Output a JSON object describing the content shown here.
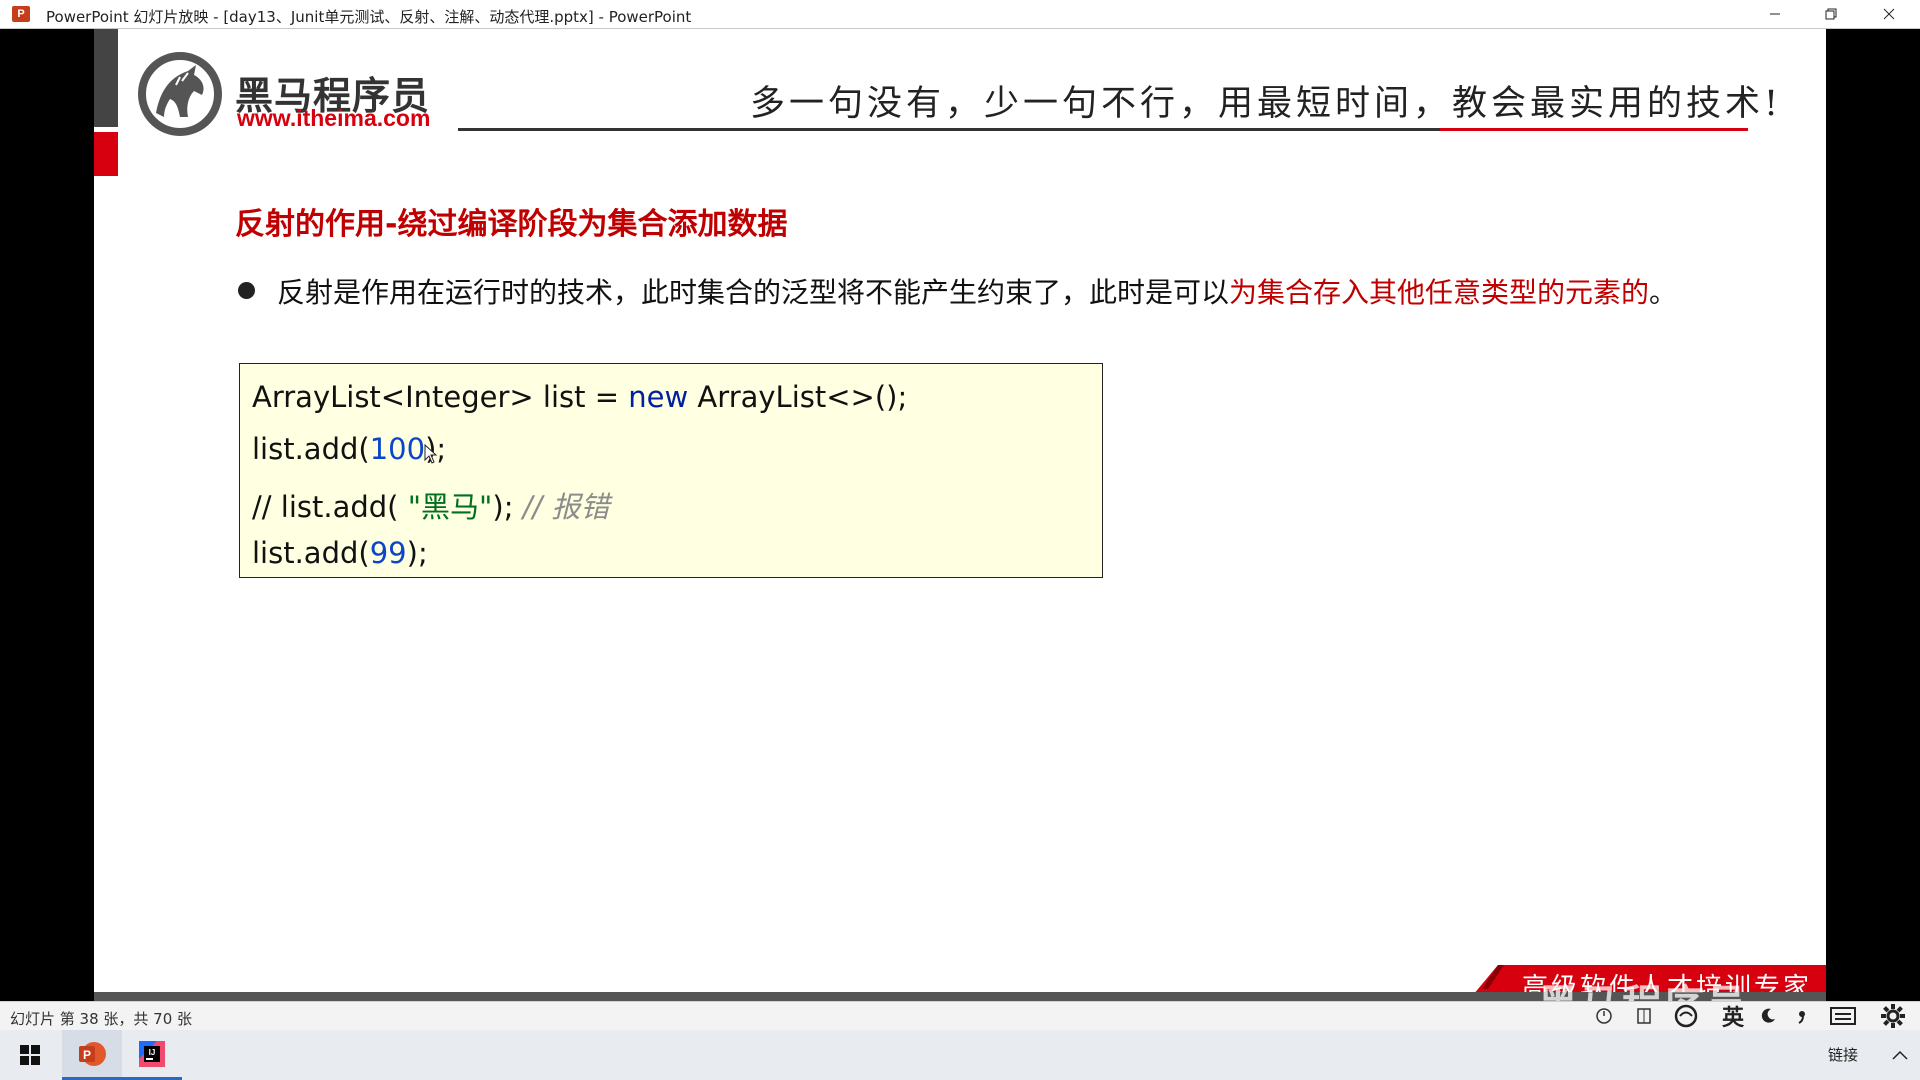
{
  "window": {
    "title": "PowerPoint 幻灯片放映 - [day13、Junit单元测试、反射、注解、动态代理.pptx] - PowerPoint",
    "app_icon_letter": "P"
  },
  "slide": {
    "brand_name": "黑马程序员",
    "brand_url": "www.itheima.com",
    "slogan": "多一句没有，少一句不行，用最短时间，教会最实用的技术!",
    "heading": "反射的作用-绕过编译阶段为集合添加数据",
    "bullet": {
      "text": "反射是作用在运行时的技术，此时集合的泛型将不能产生约束了，此时是可以",
      "highlight": "为集合存入其他任意类型的元素的",
      "end": "。"
    },
    "code": {
      "line1_a": "ArrayList<Integer> list = ",
      "line1_kw": "new",
      "line1_b": " ArrayList<>();",
      "line2_a": "list.add(",
      "line2_num": "100",
      "line2_b": ");",
      "line3_a": "// list.add( ",
      "line3_str": "\"黑马\"",
      "line3_b": "); ",
      "line3_cmt": "// 报错",
      "line4_a": "list.add(",
      "line4_num": "99",
      "line4_b": ");"
    },
    "footer_text": "高级软件人才培训专家",
    "watermark": "黑马程序员"
  },
  "status": {
    "slide_counter": "幻灯片 第 38 张，共 70 张",
    "ime_lang": "英"
  },
  "taskbar": {
    "tray_text": "链接",
    "apps": [
      {
        "icon": "powerpoint-icon",
        "active": true
      },
      {
        "icon": "intellij-icon",
        "active": false
      }
    ]
  },
  "colors": {
    "accent_red": "#d7000f",
    "heading_red": "#c00000",
    "code_bg": "#ffffe1"
  }
}
